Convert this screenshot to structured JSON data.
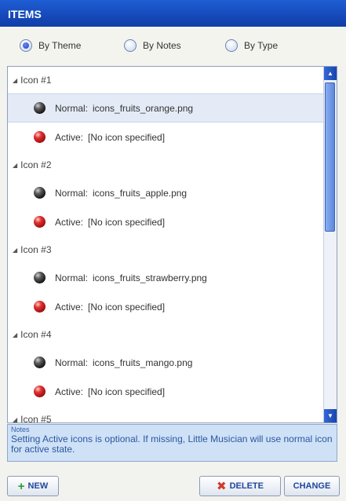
{
  "header": {
    "title": "ITEMS"
  },
  "view_options": [
    {
      "label": "By Theme",
      "checked": true
    },
    {
      "label": "By Notes",
      "checked": false
    },
    {
      "label": "By Type",
      "checked": false
    }
  ],
  "list": {
    "groups": [
      {
        "header": "Icon #1",
        "normal": {
          "key": "Normal:",
          "value": "icons_fruits_orange.png"
        },
        "active": {
          "key": "Active:",
          "value": "[No icon specified]"
        }
      },
      {
        "header": "Icon #2",
        "normal": {
          "key": "Normal:",
          "value": "icons_fruits_apple.png"
        },
        "active": {
          "key": "Active:",
          "value": "[No icon specified]"
        }
      },
      {
        "header": "Icon #3",
        "normal": {
          "key": "Normal:",
          "value": "icons_fruits_strawberry.png"
        },
        "active": {
          "key": "Active:",
          "value": "[No icon specified]"
        }
      },
      {
        "header": "Icon #4",
        "normal": {
          "key": "Normal:",
          "value": "icons_fruits_mango.png"
        },
        "active": {
          "key": "Active:",
          "value": "[No icon specified]"
        }
      },
      {
        "header": "Icon #5"
      }
    ],
    "selected_row": "Normal: icons_fruits_orange.png",
    "icons": {
      "normal": "black-ball-icon",
      "active": "red-ball-icon"
    }
  },
  "notes": {
    "label": "Notes",
    "text": "Setting Active icons is optional. If missing, Little Musician will use normal icon for active state."
  },
  "buttons": {
    "new": "NEW",
    "delete": "DELETE",
    "change": "CHANGE"
  },
  "colors": {
    "title_bar": "#1549b9",
    "notes_bg": "#cfe1f6",
    "selection": "#e4ebf6"
  }
}
